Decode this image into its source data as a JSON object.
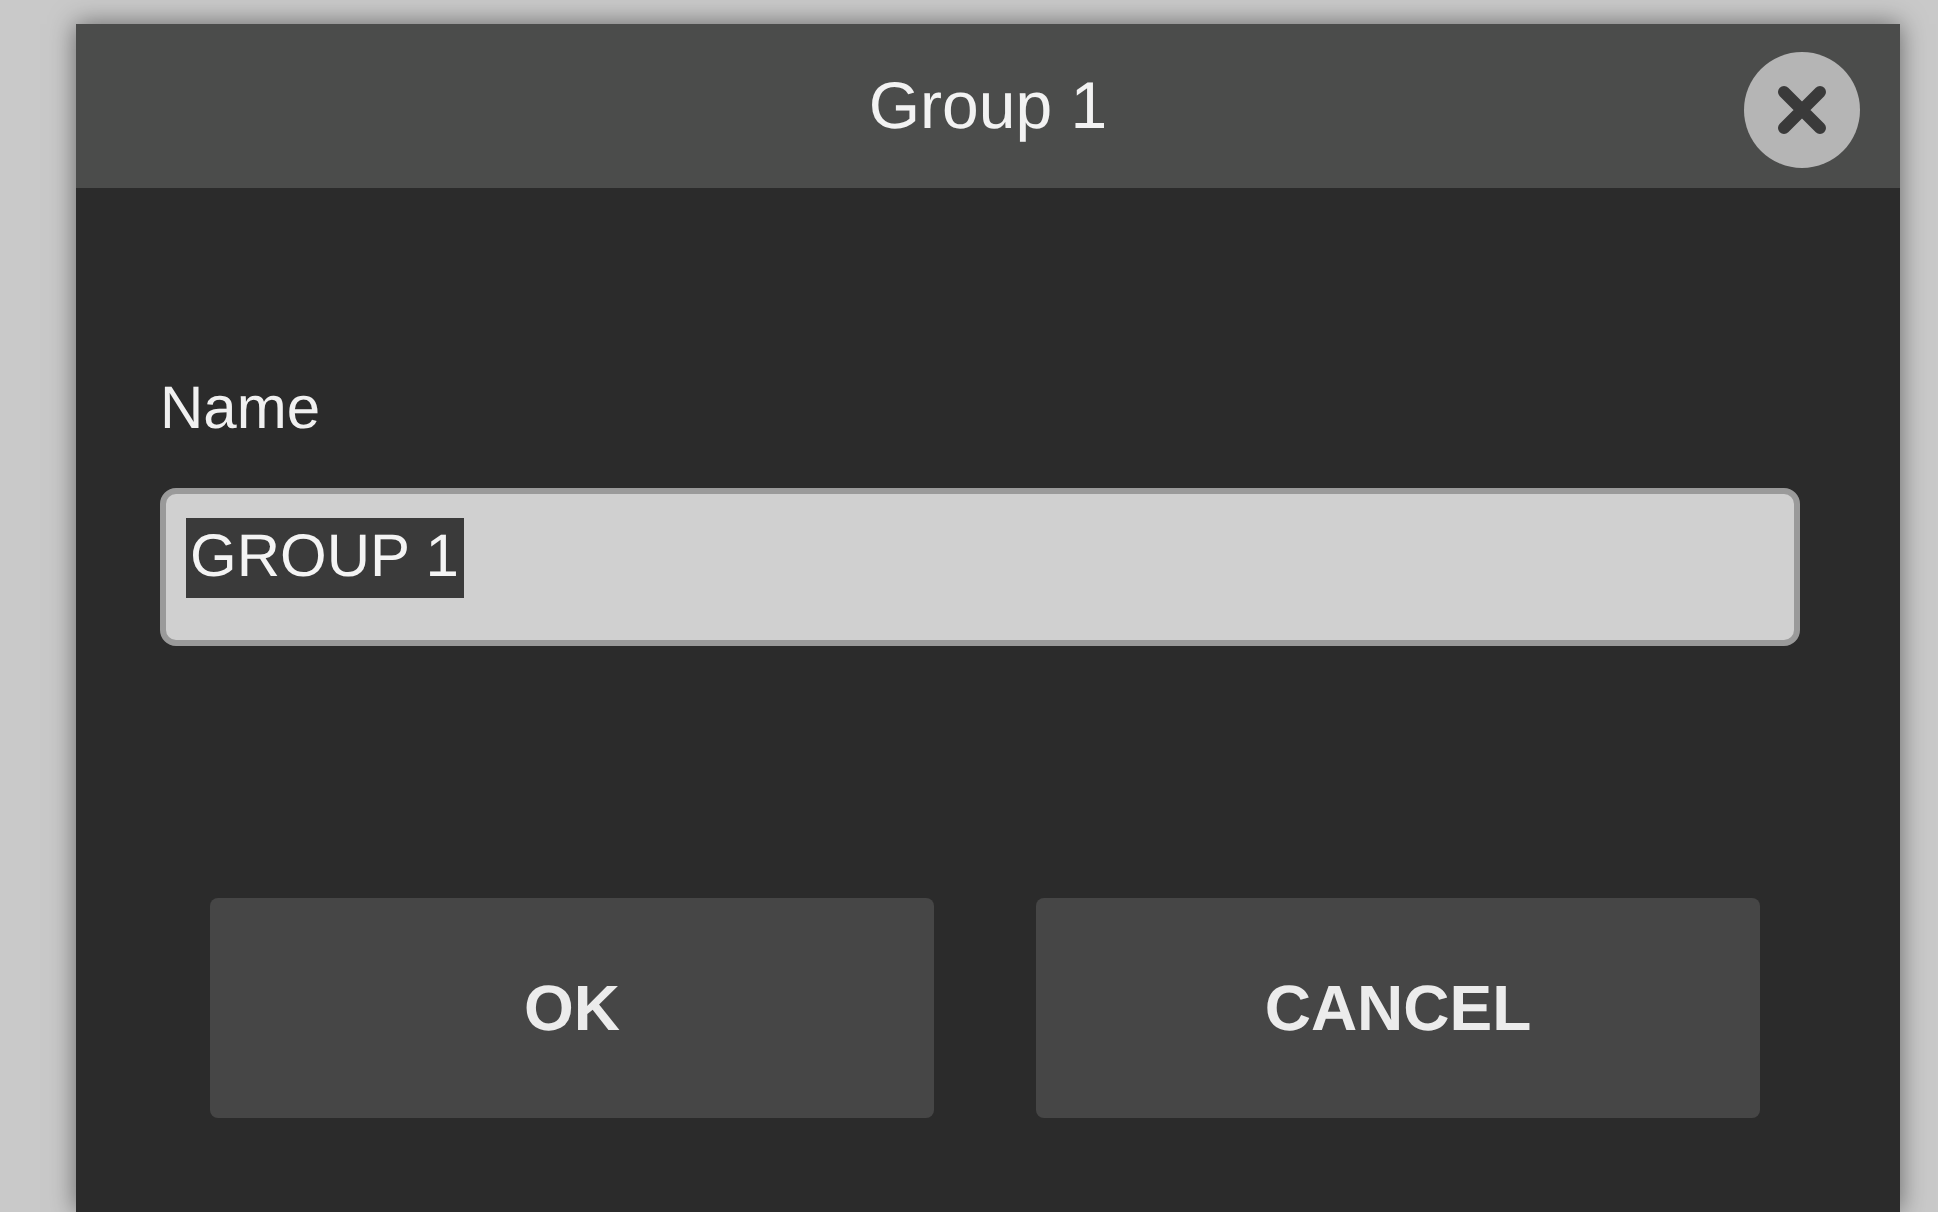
{
  "dialog": {
    "title": "Group 1"
  },
  "name_field": {
    "label": "Name",
    "value": "GROUP 1",
    "selected": true
  },
  "buttons": [
    {
      "label": "OK"
    },
    {
      "label": "CANCEL"
    }
  ]
}
